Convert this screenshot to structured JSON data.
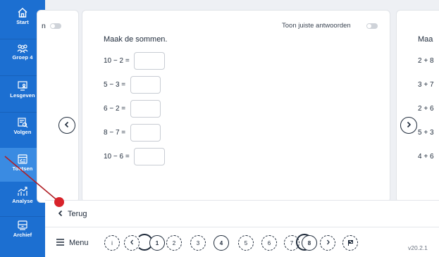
{
  "sidebar": {
    "items": [
      {
        "label": "Start",
        "icon": "home-icon"
      },
      {
        "label": "Groep 4",
        "icon": "group-icon"
      },
      {
        "label": "Lesgeven",
        "icon": "teach-icon"
      },
      {
        "label": "Volgen",
        "icon": "track-icon"
      },
      {
        "label": "Toetsen",
        "icon": "test-icon"
      },
      {
        "label": "Analyse",
        "icon": "analysis-icon"
      },
      {
        "label": "Archief",
        "icon": "archive-icon"
      }
    ]
  },
  "left_card": {
    "partial_text": "n"
  },
  "main_card": {
    "title": "Maak de sommen.",
    "toggle_label": "Toon juiste antwoorden",
    "sums": [
      "10 − 2 =",
      "5 − 3 =",
      "6 − 2 =",
      "8 − 7 =",
      "10 − 6 ="
    ]
  },
  "right_card": {
    "title_partial": "Maa",
    "sums_partial": [
      "2 + 8",
      "3 + 7",
      "2 + 6",
      "5 + 3",
      "4 + 6"
    ]
  },
  "back_bar": {
    "label": "Terug"
  },
  "bottom_bar": {
    "menu_label": "Menu",
    "pages": [
      "i",
      "1",
      "2",
      "3",
      "4",
      "5",
      "6",
      "7",
      "8"
    ],
    "version": "v20.2.1"
  },
  "colors": {
    "sidebar": "#1c6fd1",
    "sidebar_active": "#3a8be2",
    "annotation": "#d8232a",
    "background": "#eef0f4"
  }
}
